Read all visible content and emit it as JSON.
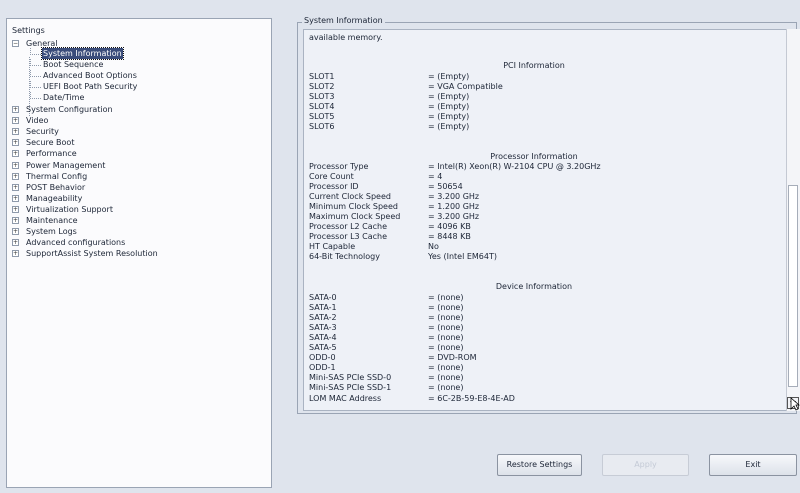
{
  "tree": {
    "root_label": "Settings",
    "general": {
      "label": "General",
      "expander": "−",
      "children": [
        "System Information",
        "Boot Sequence",
        "Advanced Boot Options",
        "UEFI Boot Path Security",
        "Date/Time"
      ],
      "selected": "System Information"
    },
    "collapsed_expander": "+",
    "items": [
      "System Configuration",
      "Video",
      "Security",
      "Secure Boot",
      "Performance",
      "Power Management",
      "Thermal Config",
      "POST Behavior",
      "Manageability",
      "Virtualization Support",
      "Maintenance",
      "System Logs",
      "Advanced configurations",
      "SupportAssist System Resolution"
    ]
  },
  "group_title": "System Information",
  "info": {
    "top_text": "available memory.",
    "pci": {
      "title": "PCI Information",
      "rows": [
        {
          "label": "SLOT1",
          "value": "= (Empty)"
        },
        {
          "label": "SLOT2",
          "value": "= VGA Compatible"
        },
        {
          "label": "SLOT3",
          "value": "= (Empty)"
        },
        {
          "label": "SLOT4",
          "value": "= (Empty)"
        },
        {
          "label": "SLOT5",
          "value": "= (Empty)"
        },
        {
          "label": "SLOT6",
          "value": "= (Empty)"
        }
      ]
    },
    "processor": {
      "title": "Processor Information",
      "rows": [
        {
          "label": "Processor Type",
          "value": "= Intel(R) Xeon(R) W-2104 CPU @ 3.20GHz"
        },
        {
          "label": "Core Count",
          "value": "= 4"
        },
        {
          "label": "Processor ID",
          "value": "= 50654"
        },
        {
          "label": "Current Clock Speed",
          "value": "= 3.200 GHz"
        },
        {
          "label": "Minimum Clock Speed",
          "value": "= 1.200 GHz"
        },
        {
          "label": "Maximum Clock Speed",
          "value": "= 3.200 GHz"
        },
        {
          "label": "Processor L2 Cache",
          "value": "= 4096 KB"
        },
        {
          "label": "Processor L3 Cache",
          "value": "= 8448 KB"
        },
        {
          "label": "HT Capable",
          "value": "No"
        },
        {
          "label": "64-Bit Technology",
          "value": "Yes (Intel EM64T)"
        }
      ]
    },
    "device": {
      "title": "Device Information",
      "rows": [
        {
          "label": "SATA-0",
          "value": "= (none)"
        },
        {
          "label": "SATA-1",
          "value": "= (none)"
        },
        {
          "label": "SATA-2",
          "value": "= (none)"
        },
        {
          "label": "SATA-3",
          "value": "= (none)"
        },
        {
          "label": "SATA-4",
          "value": "= (none)"
        },
        {
          "label": "SATA-5",
          "value": "= (none)"
        },
        {
          "label": "ODD-0",
          "value": "= DVD-ROM"
        },
        {
          "label": "ODD-1",
          "value": "= (none)"
        },
        {
          "label": "Mini-SAS PCIe SSD-0",
          "value": "= (none)"
        },
        {
          "label": "Mini-SAS PCIe SSD-1",
          "value": "= (none)"
        },
        {
          "label": "LOM MAC Address",
          "value": "= 6C-2B-59-E8-4E-AD"
        }
      ]
    }
  },
  "buttons": {
    "restore": "Restore Settings",
    "apply": "Apply",
    "exit": "Exit"
  },
  "colors": {
    "selection": "#3a4c7a",
    "background": "#dfe4ed"
  }
}
